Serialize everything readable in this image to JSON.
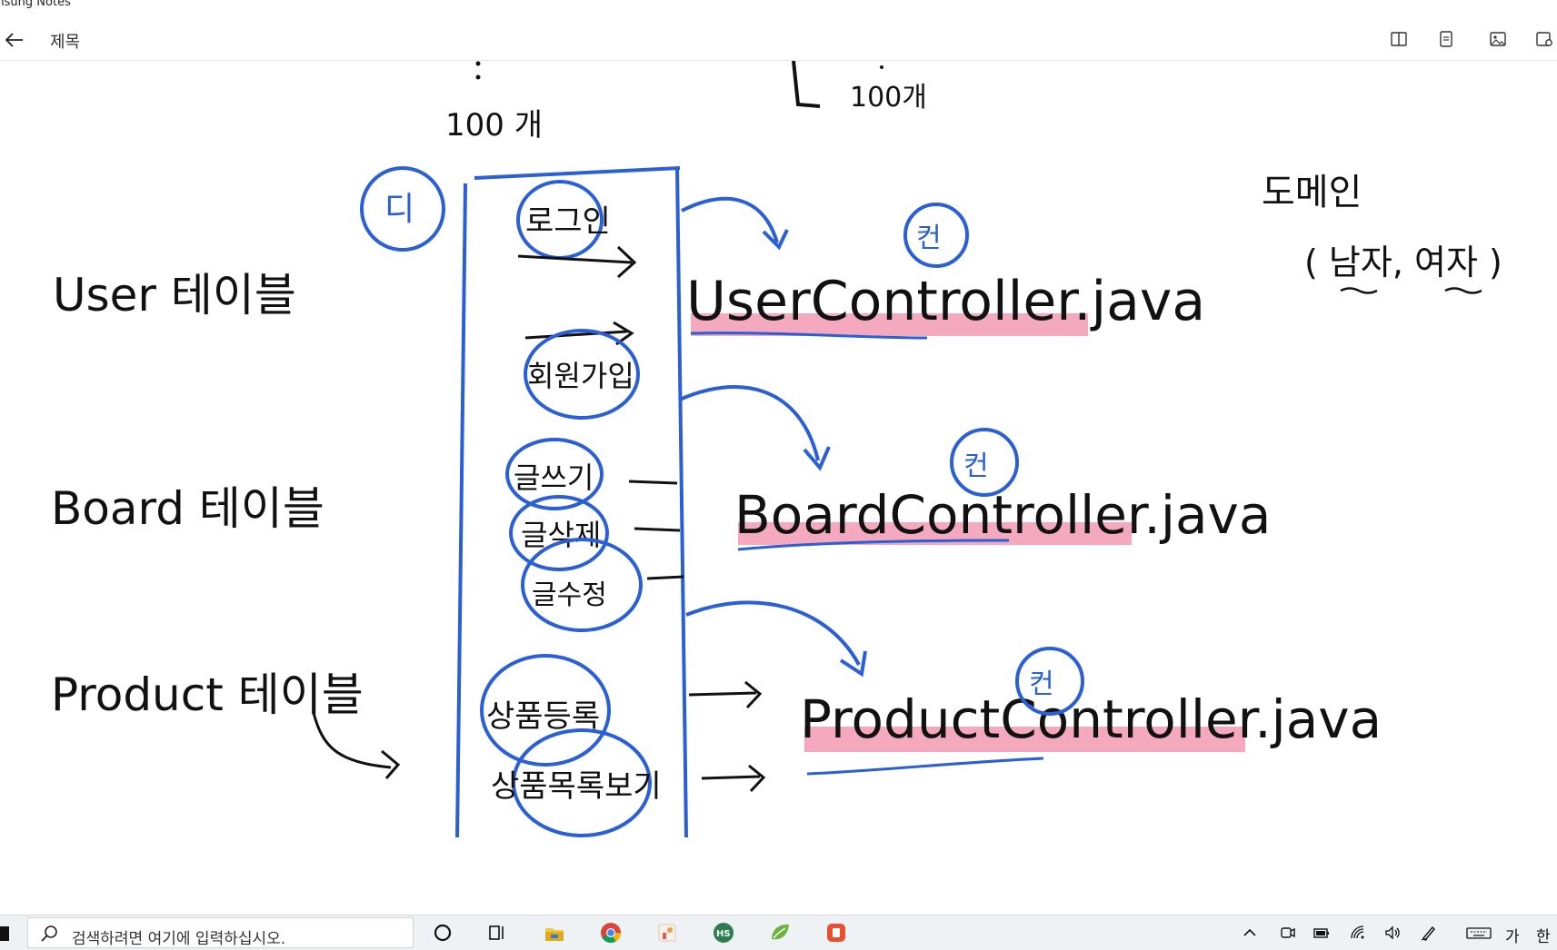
{
  "window": {
    "app_title": "msung Notes"
  },
  "toolbar": {
    "note_title": "제목",
    "buttons": [
      "reading-mode-icon",
      "page-view-icon",
      "image-icon",
      "settings-icon"
    ]
  },
  "note": {
    "tables": [
      "User 테이블",
      "Board 테이블",
      "Product 테이블"
    ],
    "counts": [
      "100 개",
      "100개"
    ],
    "domain_label": "도메인",
    "domain_values": "( 남자, 여자 )",
    "group_marker": "디",
    "actions": [
      "로그인",
      "회원가입",
      "글쓰기",
      "글삭제",
      "글수정",
      "상품등록",
      "상품목록보기"
    ],
    "controllers": [
      "UserController.java",
      "BoardController.java",
      "ProductController.java"
    ],
    "controller_marker": "컨",
    "colors": {
      "ink": "#111111",
      "pen_blue": "#2a5fd6",
      "highlight": "#f5a9bf"
    }
  },
  "taskbar": {
    "search_placeholder": "검색하려면 여기에 입력하십시오.",
    "ime_mode": "가",
    "ime_lang": "한",
    "pinned": [
      "cortana-icon",
      "task-view-icon",
      "file-explorer-icon",
      "chrome-icon",
      "app-icon",
      "hs-icon",
      "spring-icon",
      "app-red-icon"
    ]
  }
}
